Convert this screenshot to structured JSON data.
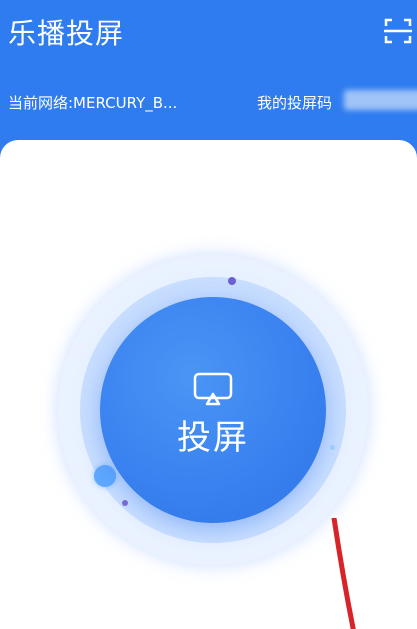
{
  "header": {
    "title": "乐播投屏",
    "network_text": "当前网络:MERCURY_B...",
    "cast_code_label": "我的投屏码",
    "cast_code_value": ""
  },
  "main": {
    "cast_button_label": "投屏",
    "cast_icon": "screen-mirror-icon"
  },
  "icons": {
    "scan": "scan-icon"
  },
  "colors": {
    "brand_blue": "#2f7cf0",
    "circle_blue": "#3a82f0",
    "background": "#ffffff",
    "pointer_red": "#d8232a"
  }
}
